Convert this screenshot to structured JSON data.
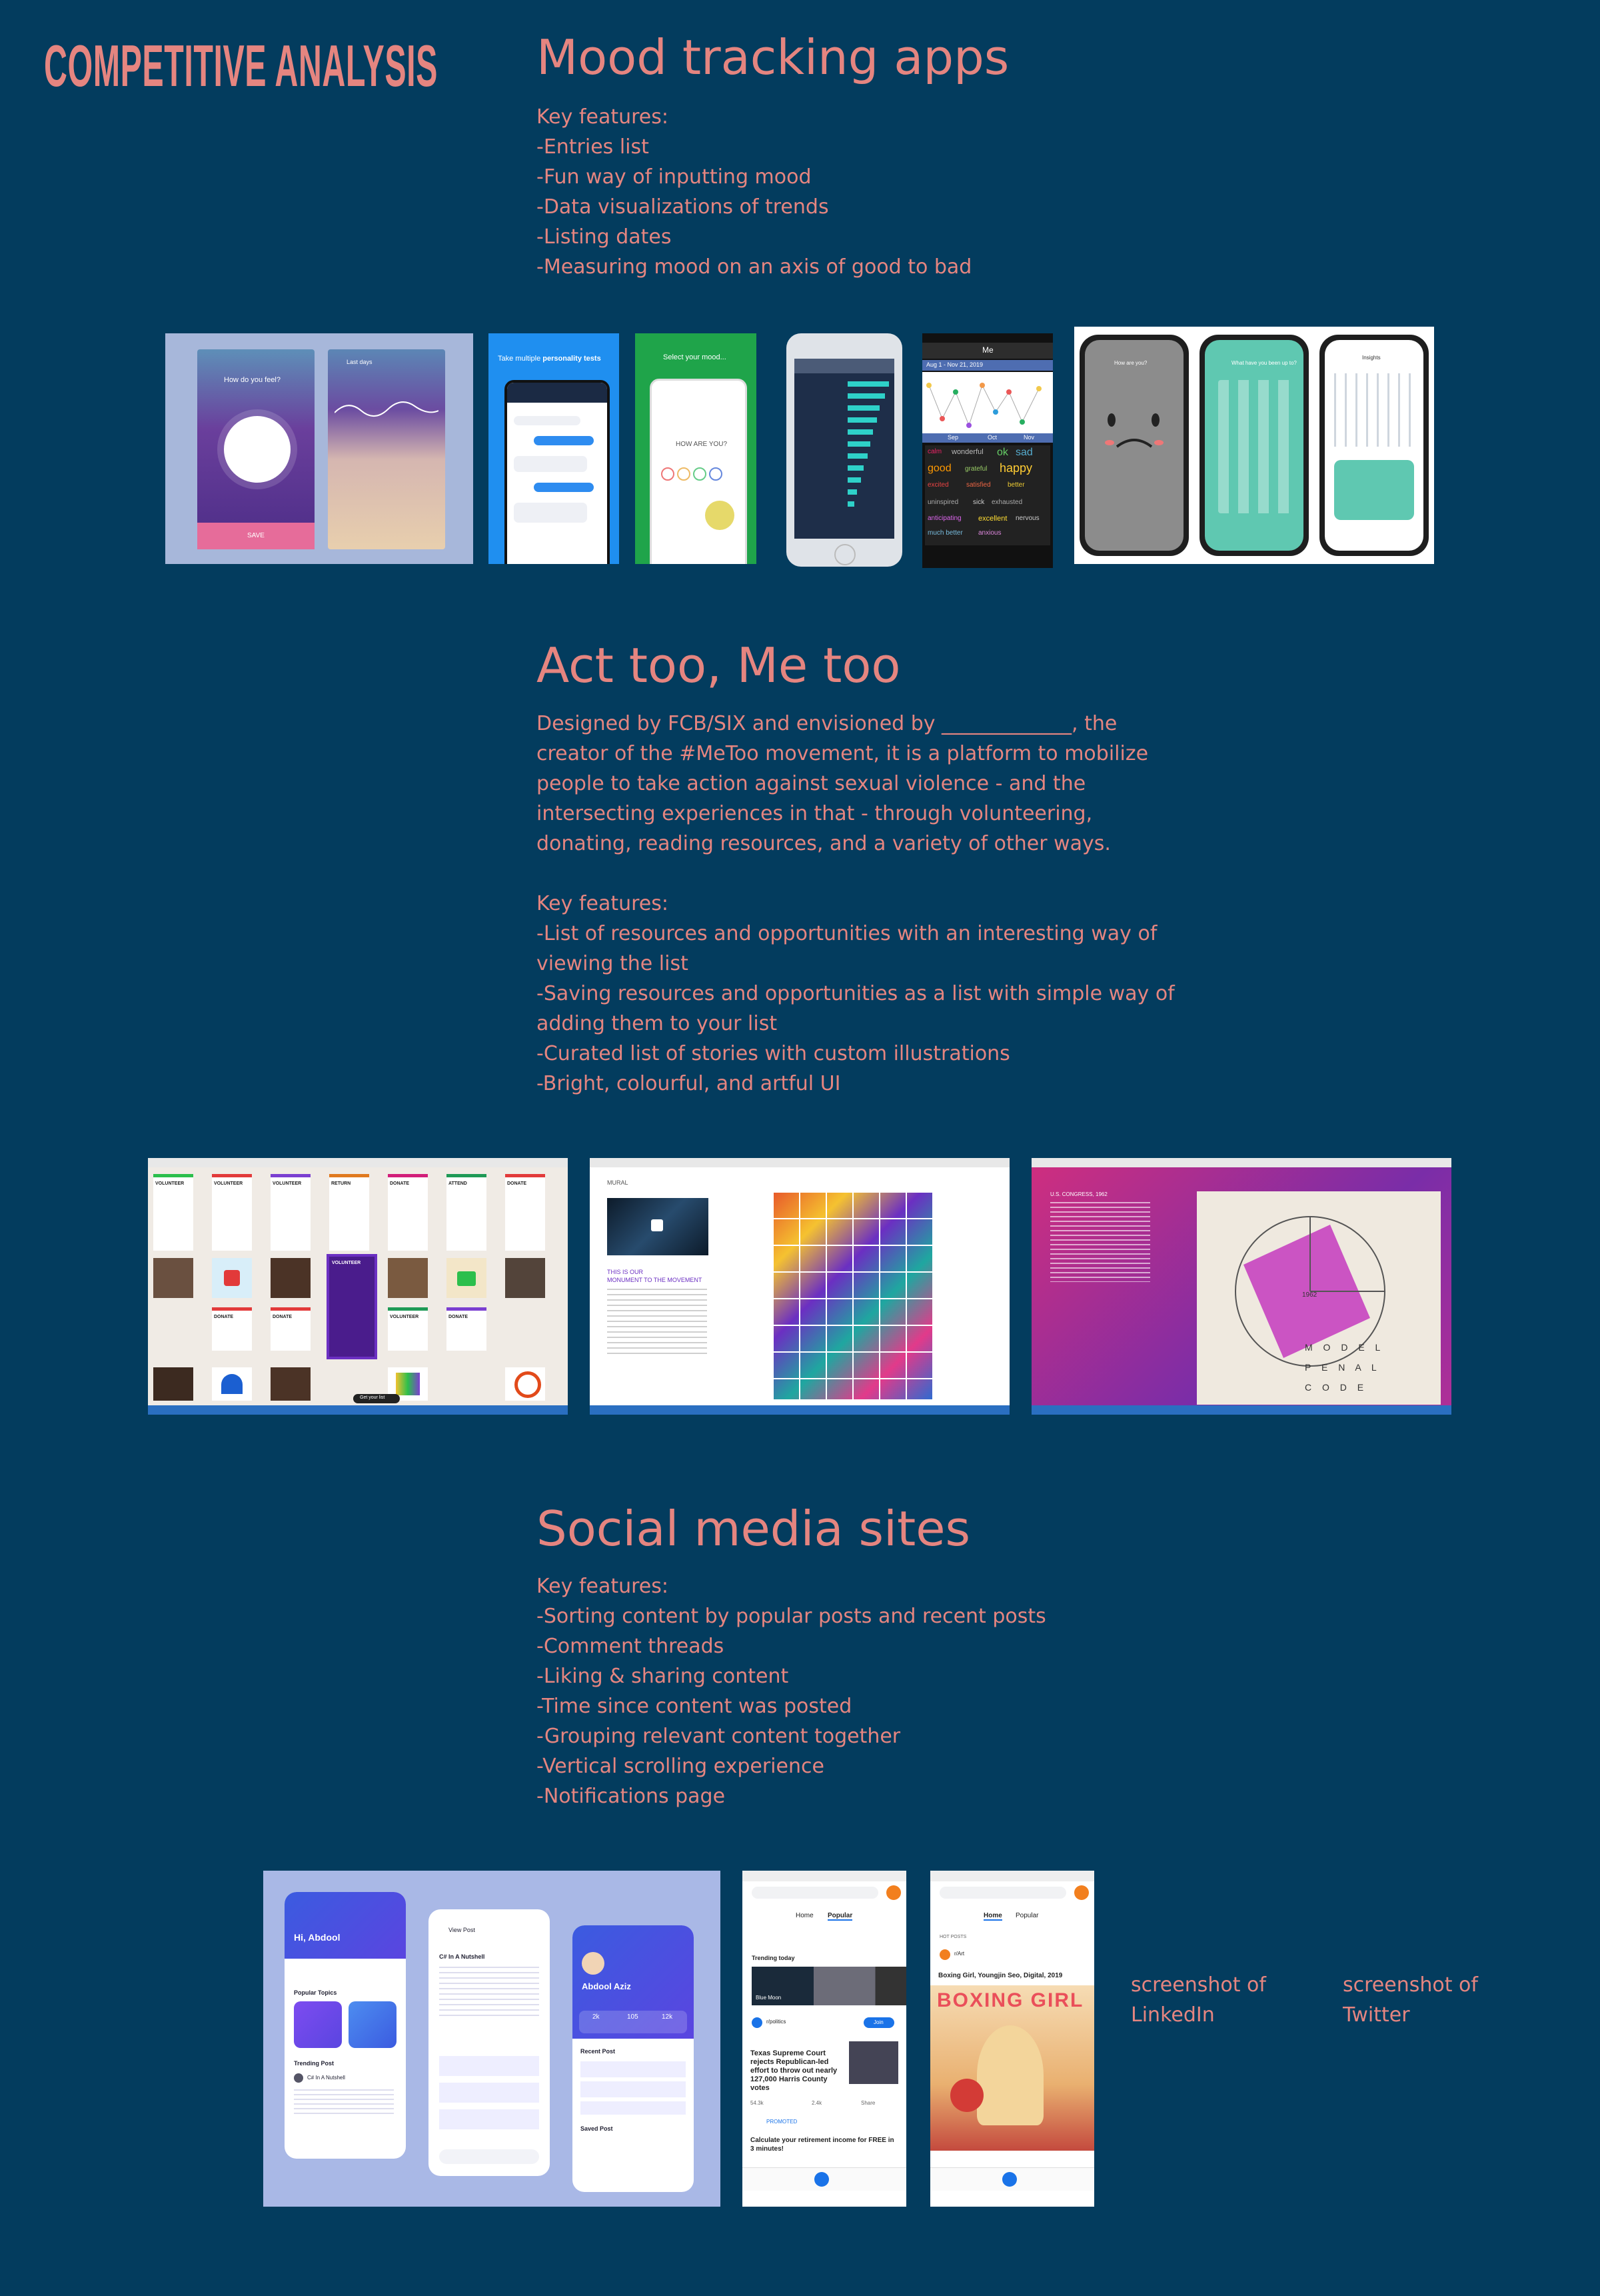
{
  "page_label": "COMPETITIVE ANALYSIS",
  "sections": {
    "mood": {
      "title": "Mood tracking apps",
      "lines": [
        "Key features:",
        "-Entries list",
        "-Fun way of inputting mood",
        "-Data visualizations of trends",
        "-Listing dates",
        "-Measuring mood on an axis of good to bad"
      ]
    },
    "metoo": {
      "title": "Act too, Me too",
      "paragraph": "Designed by FCB/SIX and envisioned by _____________, the creator of the #MeToo movement, it is a platform to mobilize people to take action against sexual violence - and the intersecting experiences in that - through volunteering, donating, reading resources, and a variety of other ways.",
      "lines": [
        "Key features:",
        "-List of resources and opportunities with an interesting way of",
        "viewing the list",
        "-Saving resources and opportunities as a list with simple way of",
        "adding them to your list",
        "-Curated list of stories with custom illustrations",
        "-Bright, colourful, and artful UI"
      ]
    },
    "social": {
      "title": "Social media sites",
      "lines": [
        "Key features:",
        "-Sorting content by popular posts and recent posts",
        "-Comment threads",
        "-Liking & sharing content",
        "-Time since content was posted",
        "-Grouping relevant content together",
        "-Vertical scrolling experience",
        "-Notifications page"
      ],
      "linkedin_caption": [
        "screenshot of",
        "LinkedIn"
      ],
      "twitter_caption": [
        "screenshot of",
        "Twitter"
      ]
    }
  },
  "mood_screens": {
    "s1": {
      "left_title": "How do you feel?",
      "right_title": "Last days",
      "button": "SAVE"
    },
    "s2": {
      "header_a": "Take multiple ",
      "header_b": "personality tests"
    },
    "s3": {
      "header": "Select your mood...",
      "question": "HOW ARE YOU?"
    },
    "s5": {
      "title": "Me",
      "range": "Aug 1 - Nov 21, 2019",
      "months": [
        "Sep",
        "Oct",
        "Nov"
      ],
      "words": [
        "calm",
        "wonderful",
        "ok",
        "sad",
        "good",
        "grateful",
        "happy",
        "excited",
        "satisfied",
        "better",
        "uninspired",
        "sick",
        "exhausted",
        "anticipating",
        "excellent",
        "nervous",
        "much better",
        "anxious"
      ]
    },
    "s6": {
      "a": "How are you?",
      "b": "What have you been up to?",
      "c": "Insights"
    }
  },
  "metoo_screens": {
    "b1": {
      "labels": [
        "VOLUNTEER",
        "VOLUNTEER",
        "VOLUNTEER",
        "RETURN",
        "DONATE",
        "ATTEND",
        "DONATE",
        "DONATE",
        "DONATE",
        "VOLUNTEER",
        "VOLUNTEER",
        "DONATE"
      ],
      "badge": "Get your list"
    },
    "b2": {
      "nav": "MURAL",
      "title_a": "THIS IS OUR",
      "title_b": "MONUMENT TO THE MOVEMENT"
    },
    "b3": {
      "org": "U.S. CONGRESS, 1962",
      "year": "1962",
      "art": [
        "M O D E L",
        "P E N A L",
        "C O D E"
      ]
    }
  },
  "social_screens": {
    "linkedin_mock": {
      "greeting": "Hi, Abdool",
      "pop": "Popular Topics",
      "trending": "Trending Post",
      "post_title": "C# In A Nutshell",
      "view_post": "View Post",
      "profile": "Abdool Aziz",
      "recent": "Recent Post",
      "saved": "Saved Post",
      "stats": [
        "2k",
        "105",
        "12k"
      ]
    },
    "reddit1": {
      "tabs": [
        "Home",
        "Popular"
      ],
      "trending": "Trending today",
      "sub": "r/politics",
      "headline": "Texas Supreme Court rejects Republican-led effort to throw out nearly 127,000 Harris County votes",
      "promo": "Calculate your retirement income for FREE in 3 minutes!",
      "join": "Join",
      "blue_moon": "Blue Moon",
      "votes": "54.3k",
      "comments": "2.4k",
      "share": "Share",
      "promoted": "PROMOTED"
    },
    "reddit2": {
      "tabs": [
        "Home",
        "Popular"
      ],
      "sub": "r/Art",
      "title": "Boxing Girl, Youngjin Seo, Digital, 2019",
      "poster_text": "BOXING GIRL",
      "hot": "HOT POSTS"
    }
  },
  "colors": {
    "background": "#033c5e",
    "accent": "#e58580"
  }
}
